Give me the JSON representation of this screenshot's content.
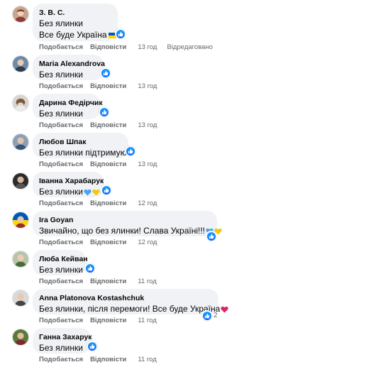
{
  "labels": {
    "like": "Подобається",
    "reply": "Відповісти",
    "edited": "Відредаговано"
  },
  "comments": [
    {
      "author": "З. В. С.",
      "lines": [
        "Без ялинки",
        "Все буде Україна"
      ],
      "time": "13 год",
      "edited": true
    },
    {
      "author": "Maria Alexandrova",
      "lines": [
        "Без ялинки"
      ],
      "time": "13 год"
    },
    {
      "author": "Дарина Федірчик",
      "lines": [
        "Без ялинки"
      ],
      "time": "13 год"
    },
    {
      "author": "Любов Шпак",
      "lines": [
        "Без ялинки підтримую."
      ],
      "time": "13 год"
    },
    {
      "author": "Іванна Харабарук",
      "lines": [
        "Без ялинки"
      ],
      "time": "12 год"
    },
    {
      "author": "Ira Goyan",
      "lines": [
        "Звичайно, що без ялинки! Слава Україні!!!"
      ],
      "time": "12 год"
    },
    {
      "author": "Люба Кейван",
      "lines": [
        "Без ялинки"
      ],
      "time": "11 год"
    },
    {
      "author": "Anna Platonova Kostashchuk",
      "lines": [
        "Без ялинки, після перемоги! Все буде Україна"
      ],
      "time": "11 год",
      "reaction_count": "2"
    },
    {
      "author": "Ганна Захарук",
      "lines": [
        "Без ялинки"
      ],
      "time": "11 год"
    }
  ],
  "colors": {
    "like_blue": "#0866ff",
    "bubble": "#f0f2f5",
    "meta": "#65676b"
  },
  "icons": [
    "like-reaction-icon",
    "ukraine-flag-icon",
    "blue-heart-icon",
    "yellow-heart-icon",
    "red-heart-icon"
  ]
}
